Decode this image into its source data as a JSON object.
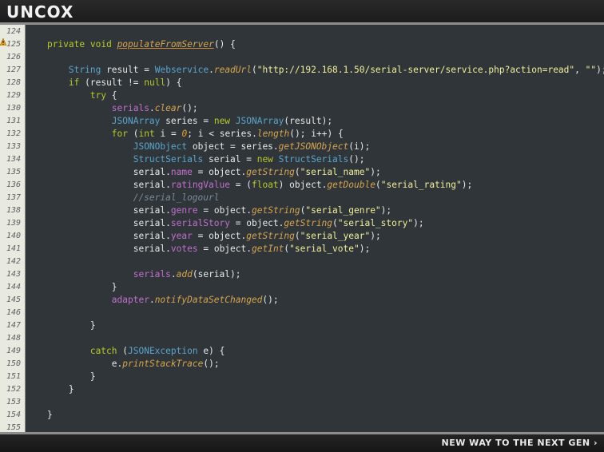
{
  "branding": {
    "logo_text": "UNCOX",
    "tagline": "NEW WAY TO THE NEXT GEN",
    "tagline_arrow": "›"
  },
  "editor": {
    "gutter_warning_icon": "warning-icon",
    "line_numbers": [
      "124",
      "125",
      "126",
      "127",
      "128",
      "129",
      "130",
      "131",
      "132",
      "133",
      "134",
      "135",
      "136",
      "137",
      "138",
      "139",
      "140",
      "141",
      "142",
      "143",
      "144",
      "145",
      "146",
      "147",
      "148",
      "149",
      "150",
      "151",
      "152",
      "153",
      "154",
      "155"
    ],
    "lines": [
      "",
      "    private void populateFromServer() {",
      "",
      "        String result = Webservice.readUrl(\"http://192.168.1.50/serial-server/service.php?action=read\", \"\");",
      "        if (result != null) {",
      "            try {",
      "                serials.clear();",
      "                JSONArray series = new JSONArray(result);",
      "                for (int i = 0; i < series.length(); i++) {",
      "                    JSONObject object = series.getJSONObject(i);",
      "                    StructSerials serial = new StructSerials();",
      "                    serial.name = object.getString(\"serial_name\");",
      "                    serial.ratingValue = (float) object.getDouble(\"serial_rating\");",
      "                    //serial_logourl",
      "                    serial.genre = object.getString(\"serial_genre\");",
      "                    serial.serialStory = object.getString(\"serial_story\");",
      "                    serial.year = object.getString(\"serial_year\");",
      "                    serial.votes = object.getInt(\"serial_vote\");",
      "",
      "                    serials.add(serial);",
      "                }",
      "                adapter.notifyDataSetChanged();",
      "",
      "            }",
      "",
      "            catch (JSONException e) {",
      "                e.printStackTrace();",
      "            }",
      "        }",
      "",
      "    }",
      ""
    ]
  },
  "colors": {
    "editor_bg": "#2f3538",
    "gutter_bg": "#e8eadf",
    "keyword": "#b7c928",
    "type": "#5ba4cf",
    "method": "#d8a44e",
    "field": "#c46ed0",
    "string": "#f2ef9a",
    "comment": "#7a8a99",
    "number": "#e6a030",
    "plain": "#e8e8e8"
  }
}
